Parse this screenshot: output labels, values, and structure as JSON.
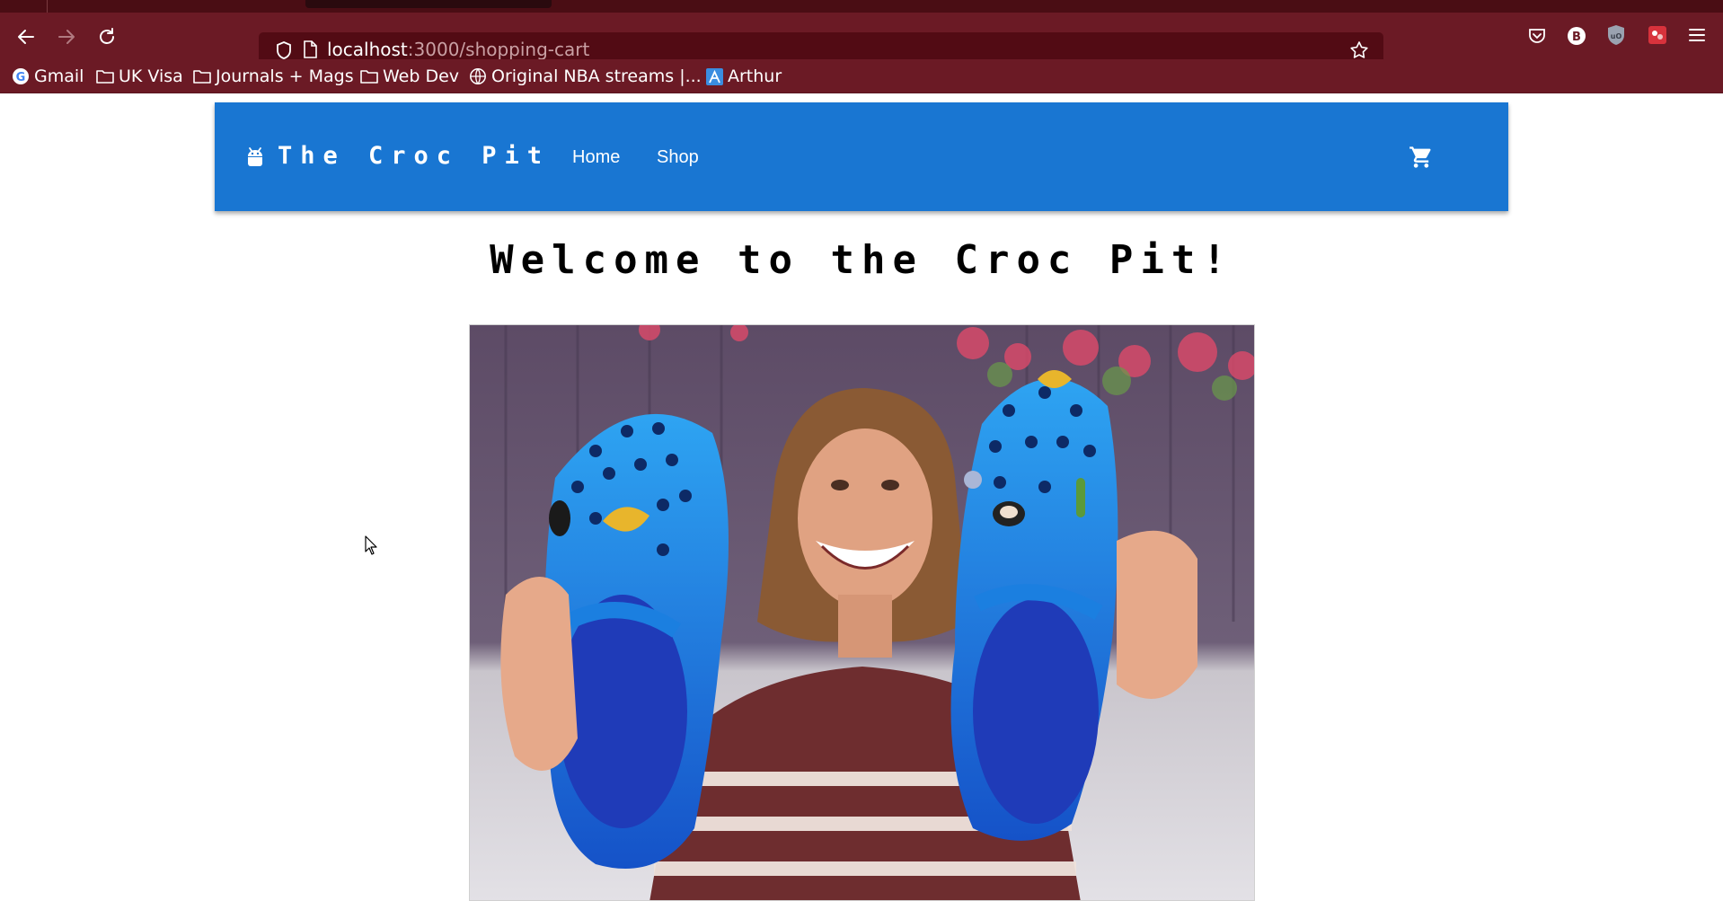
{
  "browser": {
    "url_host": "localhost",
    "url_path": ":3000/shopping-cart",
    "bookmarks": [
      {
        "label": "Gmail",
        "icon": "google-icon"
      },
      {
        "label": "UK Visa",
        "icon": "folder-icon"
      },
      {
        "label": "Journals + Mags",
        "icon": "folder-icon"
      },
      {
        "label": "Web Dev",
        "icon": "folder-icon"
      },
      {
        "label": "Original NBA streams |...",
        "icon": "globe-icon"
      },
      {
        "label": "Arthur",
        "icon": "arthur-icon"
      }
    ],
    "colors": {
      "chrome": "#6b1a25",
      "urlbar": "#520b14"
    }
  },
  "app": {
    "brand": "The Croc Pit",
    "nav": {
      "home": "Home",
      "shop": "Shop"
    },
    "cart_icon": "cart-icon",
    "header_color": "#1976d2"
  },
  "main": {
    "welcome": "Welcome to the Croc Pit!"
  }
}
